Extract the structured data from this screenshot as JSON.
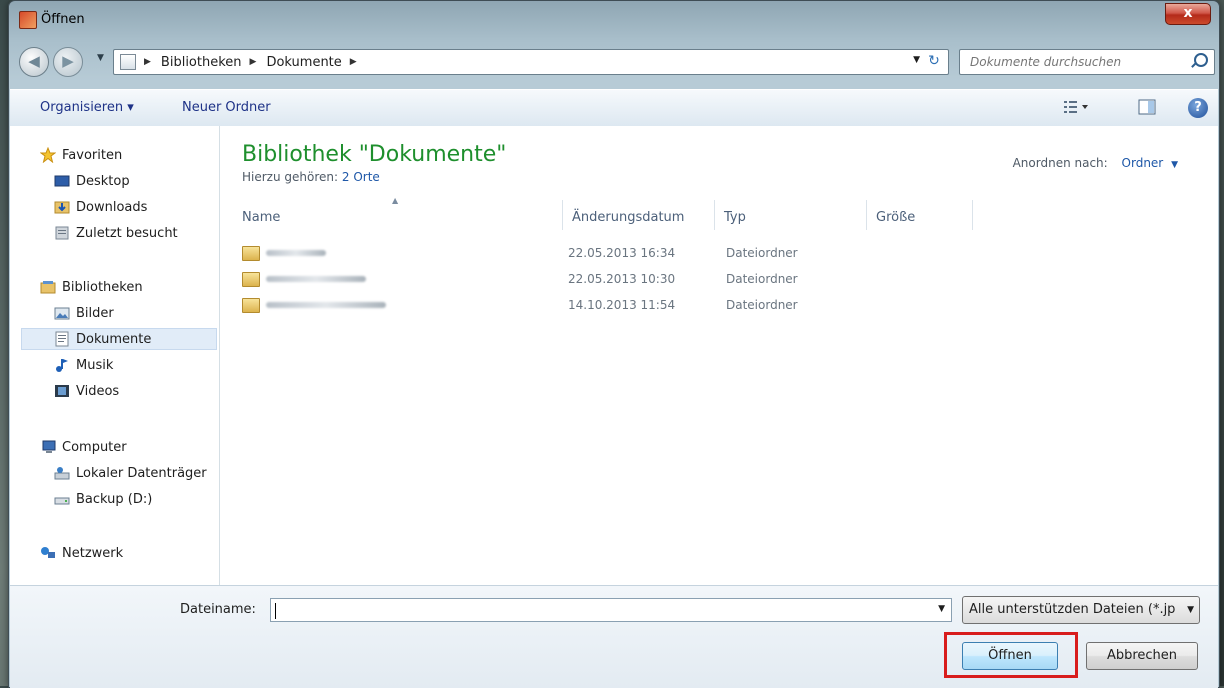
{
  "window": {
    "title": "Öffnen",
    "close_label": "x"
  },
  "nav": {
    "back_label": "◀",
    "forward_label": "▶",
    "breadcrumb": [
      "Bibliotheken",
      "Dokumente"
    ],
    "search_placeholder": "Dokumente durchsuchen"
  },
  "toolbar": {
    "organize_label": "Organisieren ▾",
    "new_folder_label": "Neuer Ordner",
    "help_label": "?"
  },
  "sidebar": {
    "favorites": {
      "label": "Favoriten",
      "items": [
        "Desktop",
        "Downloads",
        "Zuletzt besucht"
      ]
    },
    "libraries": {
      "label": "Bibliotheken",
      "items": [
        "Bilder",
        "Dokumente",
        "Musik",
        "Videos"
      ]
    },
    "computer": {
      "label": "Computer",
      "items": [
        "Lokaler Datenträger",
        "Backup (D:)"
      ]
    },
    "network": {
      "label": "Netzwerk"
    }
  },
  "main": {
    "title": "Bibliothek \"Dokumente\"",
    "subtitle_prefix": "Hierzu gehören:",
    "subtitle_link": "2 Orte",
    "arrange_label": "Anordnen nach:",
    "arrange_value": "Ordner",
    "columns": [
      "Name",
      "Änderungsdatum",
      "Typ",
      "Größe"
    ],
    "rows": [
      {
        "date": "22.05.2013 16:34",
        "type": "Dateiordner"
      },
      {
        "date": "22.05.2013 10:30",
        "type": "Dateiordner"
      },
      {
        "date": "14.10.2013 11:54",
        "type": "Dateiordner"
      }
    ]
  },
  "footer": {
    "filename_label": "Dateiname:",
    "filename_value": "",
    "filter_value": "Alle unterstützden Dateien (*.jp",
    "open_label": "Öffnen",
    "cancel_label": "Abbrechen"
  },
  "colors": {
    "accent_title": "#1e8f2d",
    "link": "#1f58a8",
    "highlight": "#d81c1c"
  }
}
